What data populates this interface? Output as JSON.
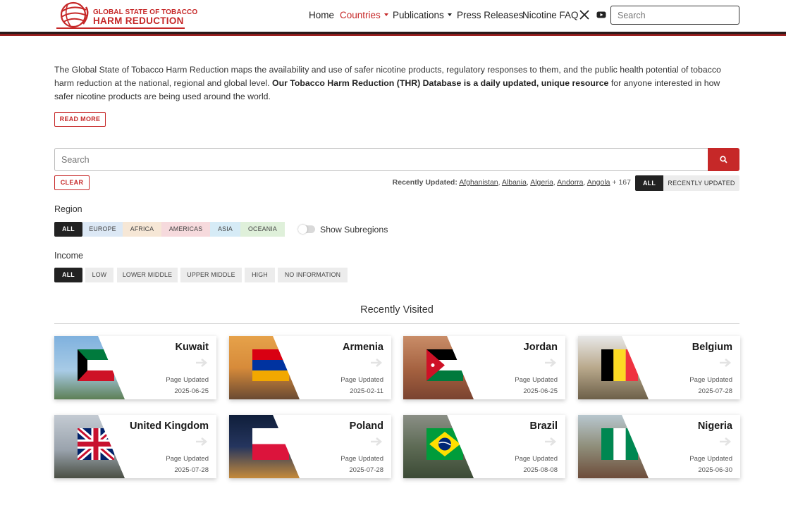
{
  "header": {
    "logo_line1": "GLOBAL STATE OF TOBACCO",
    "logo_line2": "HARM REDUCTION",
    "nav": [
      {
        "label": "Home"
      },
      {
        "label": "Countries"
      },
      {
        "label": "Publications"
      },
      {
        "label": "Press Releases"
      },
      {
        "label": "Nicotine FAQ"
      }
    ],
    "search_placeholder": "Search",
    "accent_color": "#c62828"
  },
  "intro": {
    "text_start": "The Global State of Tobacco Harm Reduction maps the availability and use of safer nicotine products, regulatory responses to them, and the public health potential of tobacco harm reduction at the national, regional and global level. ",
    "text_bold": "Our Tobacco Harm Reduction (THR) Database is a daily updated, unique resource",
    "text_end": " for anyone interested in how safer nicotine products are being used around the world.",
    "read_more": "READ MORE"
  },
  "search": {
    "placeholder": "Search",
    "clear": "CLEAR",
    "recently_updated_label": "Recently Updated:",
    "recently_updated": [
      "Afghanistan",
      "Albania",
      "Algeria",
      "Andorra",
      "Angola"
    ],
    "more_count": "+ 167",
    "toggle_all": "ALL",
    "toggle_recent": "RECENTLY UPDATED"
  },
  "region": {
    "label": "Region",
    "chips": [
      {
        "label": "ALL",
        "color": "#222222"
      },
      {
        "label": "EUROPE",
        "color": "#dce8f5"
      },
      {
        "label": "AFRICA",
        "color": "#f6e7d6"
      },
      {
        "label": "AMERICAS",
        "color": "#f6dadd"
      },
      {
        "label": "ASIA",
        "color": "#d6ebf6"
      },
      {
        "label": "OCEANIA",
        "color": "#dff0da"
      }
    ],
    "subregions_label": "Show Subregions"
  },
  "income": {
    "label": "Income",
    "chips": [
      "ALL",
      "LOW",
      "LOWER MIDDLE",
      "UPPER MIDDLE",
      "HIGH",
      "NO INFORMATION"
    ]
  },
  "recently_visited": {
    "title": "Recently Visited",
    "updated_label": "Page Updated",
    "cards": [
      {
        "country": "Kuwait",
        "date": "2025-06-25"
      },
      {
        "country": "Armenia",
        "date": "2025-02-11"
      },
      {
        "country": "Jordan",
        "date": "2025-06-25"
      },
      {
        "country": "Belgium",
        "date": "2025-07-28"
      },
      {
        "country": "United Kingdom",
        "date": "2025-07-28"
      },
      {
        "country": "Poland",
        "date": "2025-07-28"
      },
      {
        "country": "Brazil",
        "date": "2025-08-08"
      },
      {
        "country": "Nigeria",
        "date": "2025-06-30"
      }
    ]
  }
}
